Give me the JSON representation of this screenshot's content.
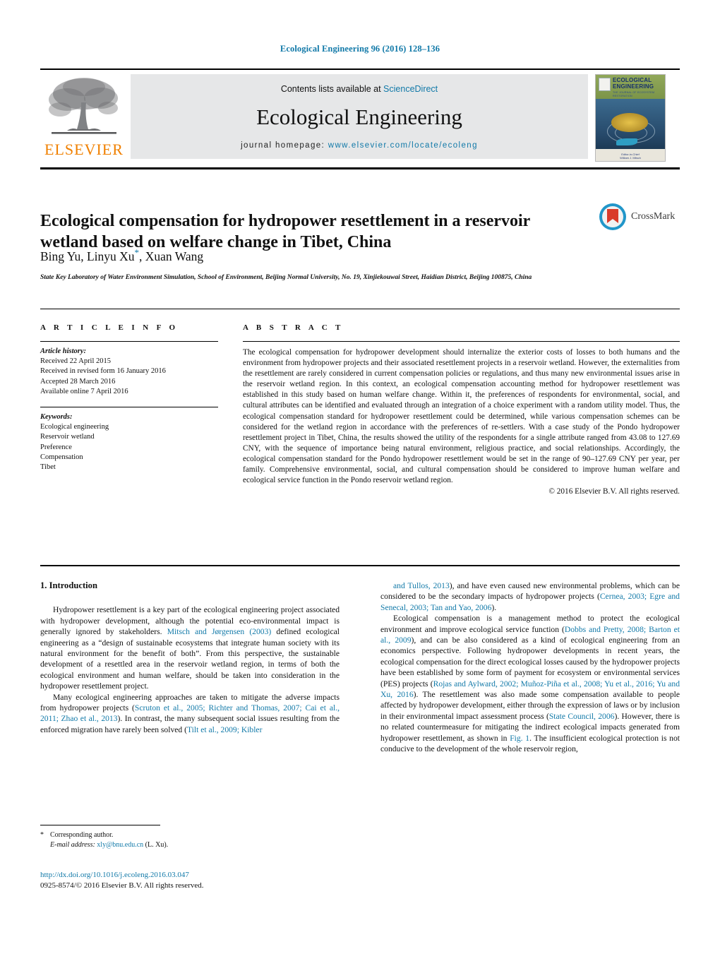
{
  "running_head": "Ecological Engineering 96 (2016) 128–136",
  "masthead": {
    "contents_prefix": "Contents lists available at ",
    "contents_link": "ScienceDirect",
    "journal_title": "Ecological Engineering",
    "homepage_prefix": "journal homepage: ",
    "homepage_url": "www.elsevier.com/locate/ecoleng",
    "publisher_name": "ELSEVIER",
    "cover": {
      "title_line1": "ECOLOGICAL",
      "title_line2": "ENGINEERING",
      "subtitle": "THE JOURNAL OF ECOSYSTEM RESTORATION",
      "footer_line1": "Editor-in-Chief",
      "footer_line2": "William J. Mitsch"
    }
  },
  "article": {
    "title": "Ecological compensation for hydropower resettlement in a reservoir wetland based on welfare change in Tibet, China",
    "authors_pre": "Bing Yu, Linyu Xu",
    "authors_star": "*",
    "authors_post": ", Xuan Wang",
    "affiliation": "State Key Laboratory of Water Environment Simulation, School of Environment, Beijing Normal University, No. 19, Xinjiekouwai Street, Haidian District, Beijing 100875, China",
    "crossmark_label": "CrossMark"
  },
  "article_info": {
    "heading": "A R T I C L E   I N F O",
    "history_label": "Article history:",
    "history": [
      "Received 22 April 2015",
      "Received in revised form 16 January 2016",
      "Accepted 28 March 2016",
      "Available online 7 April 2016"
    ],
    "keywords_label": "Keywords:",
    "keywords": [
      "Ecological engineering",
      "Reservoir wetland",
      "Preference",
      "Compensation",
      "Tibet"
    ]
  },
  "abstract": {
    "heading": "A B S T R A C T",
    "text": "The ecological compensation for hydropower development should internalize the exterior costs of losses to both humans and the environment from hydropower projects and their associated resettlement projects in a reservoir wetland. However, the externalities from the resettlement are rarely considered in current compensation policies or regulations, and thus many new environmental issues arise in the reservoir wetland region. In this context, an ecological compensation accounting method for hydropower resettlement was established in this study based on human welfare change. Within it, the preferences of respondents for environmental, social, and cultural attributes can be identified and evaluated through an integration of a choice experiment with a random utility model. Thus, the ecological compensation standard for hydropower resettlement could be determined, while various compensation schemes can be considered for the wetland region in accordance with the preferences of re-settlers. With a case study of the Pondo hydropower resettlement project in Tibet, China, the results showed the utility of the respondents for a single attribute ranged from 43.08 to 127.69 CNY, with the sequence of importance being natural environment, religious practice, and social relationships. Accordingly, the ecological compensation standard for the Pondo hydropower resettlement would be set in the range of 90–127.69 CNY per year, per family. Comprehensive environmental, social, and cultural compensation should be considered to improve human welfare and ecological service function in the Pondo reservoir wetland region.",
    "copyright": "© 2016 Elsevier B.V. All rights reserved."
  },
  "introduction": {
    "heading": "1. Introduction",
    "left_paragraphs": [
      {
        "segments": [
          {
            "text": "Hydropower resettlement is a key part of the ecological engineering project associated with hydropower development, although the potential eco-environmental impact is generally ignored by stakeholders. ",
            "cite": false
          },
          {
            "text": "Mitsch and Jørgensen (2003)",
            "cite": true
          },
          {
            "text": " defined ecological engineering as a “design of sustainable ecosystems that integrate human society with its natural environment for the benefit of both”. From this perspective, the sustainable development of a resettled area in the reservoir wetland region, in terms of both the ecological environment and human welfare, should be taken into consideration in the hydropower resettlement project.",
            "cite": false
          }
        ]
      },
      {
        "segments": [
          {
            "text": "Many ecological engineering approaches are taken to mitigate the adverse impacts from hydropower projects (",
            "cite": false
          },
          {
            "text": "Scruton et al., 2005; Richter and Thomas, 2007; Cai et al., 2011; Zhao et al., 2013",
            "cite": true
          },
          {
            "text": "). In contrast, the many subsequent social issues resulting from the enforced migration have rarely been solved (",
            "cite": false
          },
          {
            "text": "Tilt et al., 2009; Kibler",
            "cite": true
          }
        ]
      }
    ],
    "right_paragraphs": [
      {
        "segments": [
          {
            "text": "and Tullos, 2013",
            "cite": true
          },
          {
            "text": "), and have even caused new environmental problems, which can be considered to be the secondary impacts of hydropower projects (",
            "cite": false
          },
          {
            "text": "Cernea, 2003; Egre and Senecal, 2003; Tan and Yao, 2006",
            "cite": true
          },
          {
            "text": ").",
            "cite": false
          }
        ]
      },
      {
        "segments": [
          {
            "text": "Ecological compensation is a management method to protect the ecological environment and improve ecological service function (",
            "cite": false
          },
          {
            "text": "Dobbs and Pretty, 2008; Barton et al., 2009",
            "cite": true
          },
          {
            "text": "), and can be also considered as a kind of ecological engineering from an economics perspective. Following hydropower developments in recent years, the ecological compensation for the direct ecological losses caused by the hydropower projects have been established by some form of payment for ecosystem or environmental services (PES) projects (",
            "cite": false
          },
          {
            "text": "Rojas and Aylward, 2002; Muñoz-Piña et al., 2008; Yu et al., 2016; Yu and Xu, 2016",
            "cite": true
          },
          {
            "text": "). The resettlement was also made some compensation available to people affected by hydropower development, either through the expression of laws or by inclusion in their environmental impact assessment process (",
            "cite": false
          },
          {
            "text": "State Council, 2006",
            "cite": true
          },
          {
            "text": "). However, there is no related countermeasure for mitigating the indirect ecological impacts generated from hydropower resettlement, as shown in ",
            "cite": false
          },
          {
            "text": "Fig. 1",
            "cite": true
          },
          {
            "text": ". The insufficient ecological protection is not conducive to the development of the whole reservoir region,",
            "cite": false
          }
        ]
      }
    ]
  },
  "footnotes": {
    "corresponding_marker": "*",
    "corresponding_label": "Corresponding author.",
    "email_label": "E-mail address:",
    "email": "xly@bnu.edu.cn",
    "email_owner": "(L. Xu)."
  },
  "doi": {
    "url": "http://dx.doi.org/10.1016/j.ecoleng.2016.03.047",
    "issn_line": "0925-8574/© 2016 Elsevier B.V. All rights reserved."
  },
  "colors": {
    "link": "#1179a8",
    "elsevier_orange": "#f08000",
    "crossmark_red": "#d93b2b",
    "crossmark_blue": "#2196c9"
  }
}
